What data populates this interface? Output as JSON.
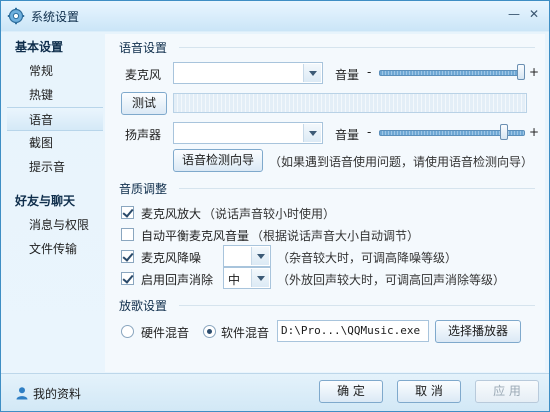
{
  "window": {
    "title": "系统设置"
  },
  "sidebar": {
    "groups": [
      {
        "label": "基本设置",
        "items": [
          "常规",
          "热键",
          "语音",
          "截图",
          "提示音"
        ]
      },
      {
        "label": "好友与聊天",
        "items": [
          "消息与权限",
          "文件传输"
        ]
      }
    ],
    "active_item": "语音"
  },
  "voice": {
    "section_title": "语音设置",
    "mic_label": "麦克风",
    "mic_value": "",
    "volume_label": "音量",
    "minus": "-",
    "plus": "+",
    "mic_volume_percent": 100,
    "test_button": "测试",
    "speaker_label": "扬声器",
    "speaker_value": "",
    "speaker_volume_percent": 88,
    "wizard_button": "语音检测向导",
    "wizard_note": "（如果遇到语音使用问题，请使用语音检测向导）"
  },
  "quality": {
    "section_title": "音质调整",
    "options": [
      {
        "label": "麦克风放大",
        "note": "（说话声音较小时使用）",
        "checked": true
      },
      {
        "label": "自动平衡麦克风音量",
        "note": "（根据说话声音大小自动调节）",
        "checked": false
      },
      {
        "label": "麦克风降噪",
        "note": "（杂音较大时，可调高降噪等级）",
        "checked": true,
        "select_value": ""
      },
      {
        "label": "启用回声消除",
        "note": "（外放回声较大时，可调高回声消除等级）",
        "checked": true,
        "select_value": "中"
      }
    ]
  },
  "music": {
    "section_title": "放歌设置",
    "hardware_label": "硬件混音",
    "software_label": "软件混音",
    "selected": "软件混音",
    "player_path": "D:\\Pro...\\QQMusic.exe",
    "choose_button": "选择播放器"
  },
  "footer": {
    "profile_label": "我的资料",
    "ok": "确 定",
    "cancel": "取 消",
    "apply": "应 用"
  },
  "icons": {
    "title": "gear-icon",
    "minimize": "minimize-icon",
    "close": "close-icon",
    "profile": "user-icon"
  },
  "colors": {
    "accent": "#3e8ec4",
    "title_bg": "#cbe5f7"
  }
}
